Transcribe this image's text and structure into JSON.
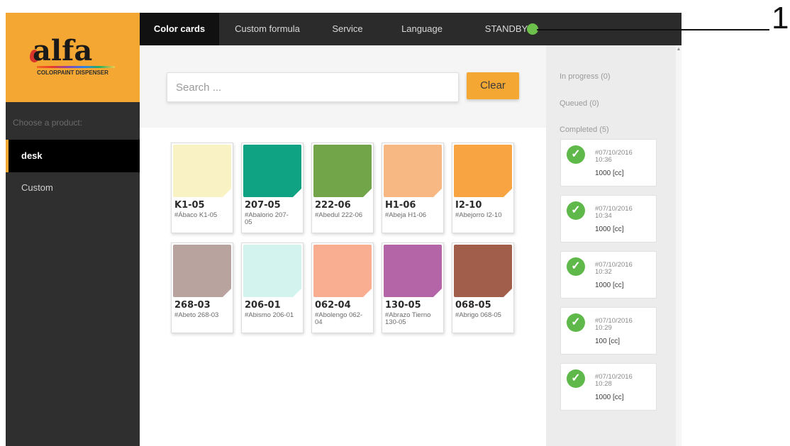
{
  "sidebar": {
    "logo": {
      "brand": "alfa",
      "tagline": "COLORPAINT DISPENSER"
    },
    "choose_label": "Choose a product:",
    "items": [
      {
        "label": "desk",
        "selected": true
      },
      {
        "label": "Custom",
        "selected": false
      }
    ]
  },
  "topnav": {
    "tabs": [
      {
        "label": "Color cards",
        "active": true
      },
      {
        "label": "Custom formula",
        "active": false
      },
      {
        "label": "Service",
        "active": false
      },
      {
        "label": "Language",
        "active": false
      }
    ],
    "status": {
      "label": "STANDBY",
      "indicator_color": "#6dbf4b"
    }
  },
  "search": {
    "placeholder": "Search ...",
    "value": "",
    "clear_label": "Clear"
  },
  "colors": {
    "accent": "#f5a733",
    "sidebar_bg": "#2f2f2f",
    "nav_bg": "#2b2b2b",
    "success": "#5fb84a"
  },
  "cards": [
    {
      "code": "K1-05",
      "name": "#Ábaco K1-05",
      "color": "#f8f2c4"
    },
    {
      "code": "207-05",
      "name": "#Abalorio 207-05",
      "color": "#10a383"
    },
    {
      "code": "222-06",
      "name": "#Abedul 222-06",
      "color": "#72a54a"
    },
    {
      "code": "H1-06",
      "name": "#Abeja H1-06",
      "color": "#f8b883"
    },
    {
      "code": "I2-10",
      "name": "#Abejorro I2-10",
      "color": "#f8a443"
    },
    {
      "code": "268-03",
      "name": "#Abeto 268-03",
      "color": "#b8a39e"
    },
    {
      "code": "206-01",
      "name": "#Abismo 206-01",
      "color": "#d3f3ee"
    },
    {
      "code": "062-04",
      "name": "#Abolengo 062-04",
      "color": "#f9ae92"
    },
    {
      "code": "130-05",
      "name": "#Abrazo Tierno 130-05",
      "color": "#b465a7"
    },
    {
      "code": "068-05",
      "name": "#Abrigo 068-05",
      "color": "#a05e4b"
    }
  ],
  "queue": {
    "in_progress_label": "In progress (0)",
    "queued_label": "Queued (0)",
    "completed_label": "Completed (5)",
    "completed": [
      {
        "date": "#07/10/2016",
        "time": "10:36",
        "qty": "1000 [cc]"
      },
      {
        "date": "#07/10/2016",
        "time": "10:34",
        "qty": "1000 [cc]"
      },
      {
        "date": "#07/10/2016",
        "time": "10:32",
        "qty": "1000 [cc]"
      },
      {
        "date": "#07/10/2016",
        "time": "10:29",
        "qty": "100 [cc]"
      },
      {
        "date": "#07/10/2016",
        "time": "10:28",
        "qty": "1000 [cc]"
      }
    ]
  },
  "callout": {
    "number": "1"
  }
}
